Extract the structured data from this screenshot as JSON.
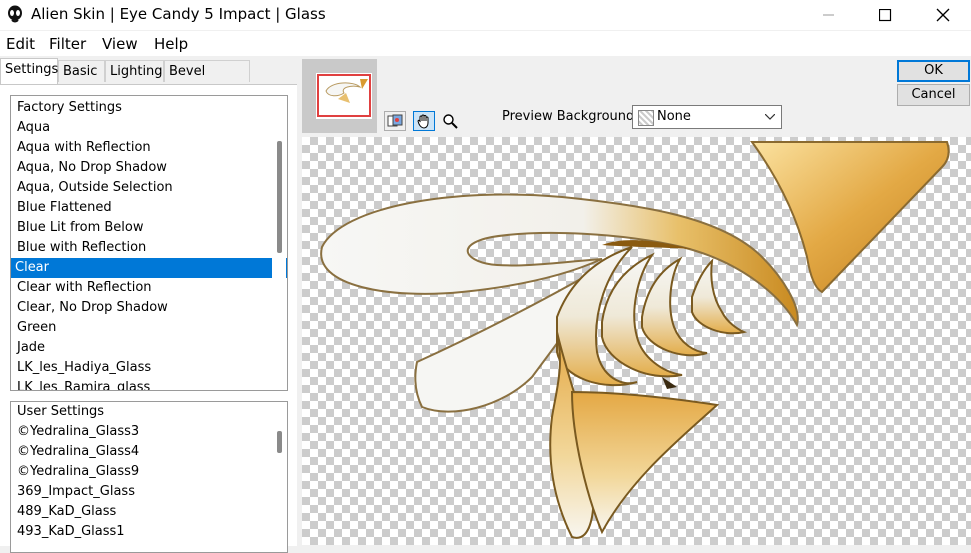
{
  "window": {
    "title": "Alien Skin | Eye Candy 5 Impact | Glass"
  },
  "menu": [
    "Edit",
    "Filter",
    "View",
    "Help"
  ],
  "tabs": [
    "Settings",
    "Basic",
    "Lighting",
    "Bevel Profile"
  ],
  "active_tab": "Settings",
  "factory_settings": {
    "header": "Factory Settings",
    "items": [
      "Aqua",
      "Aqua with Reflection",
      "Aqua, No Drop Shadow",
      "Aqua, Outside Selection",
      "Blue Flattened",
      "Blue Lit from Below",
      "Blue with Reflection",
      "Clear",
      "Clear with Reflection",
      "Clear, No Drop Shadow",
      "Green",
      "Jade",
      "LK_les_Hadiya_Glass",
      "LK_les_Ramira_glass"
    ],
    "selected": "Clear"
  },
  "user_settings": {
    "header": "User Settings",
    "items": [
      "©Yedralina_Glass3",
      "©Yedralina_Glass4",
      "©Yedralina_Glass9",
      "369_Impact_Glass",
      "489_KaD_Glass",
      "493_KaD_Glass1"
    ]
  },
  "buttons": {
    "ok": "OK",
    "cancel": "Cancel"
  },
  "preview_background": {
    "label": "Preview Background:",
    "value": "None"
  },
  "tools": [
    "toggle-preview-icon",
    "hand-icon",
    "zoom-icon"
  ],
  "colors": {
    "selection": "#0078d7",
    "accent_gold": "#d9a030",
    "thumb_frame": "#e04040"
  }
}
